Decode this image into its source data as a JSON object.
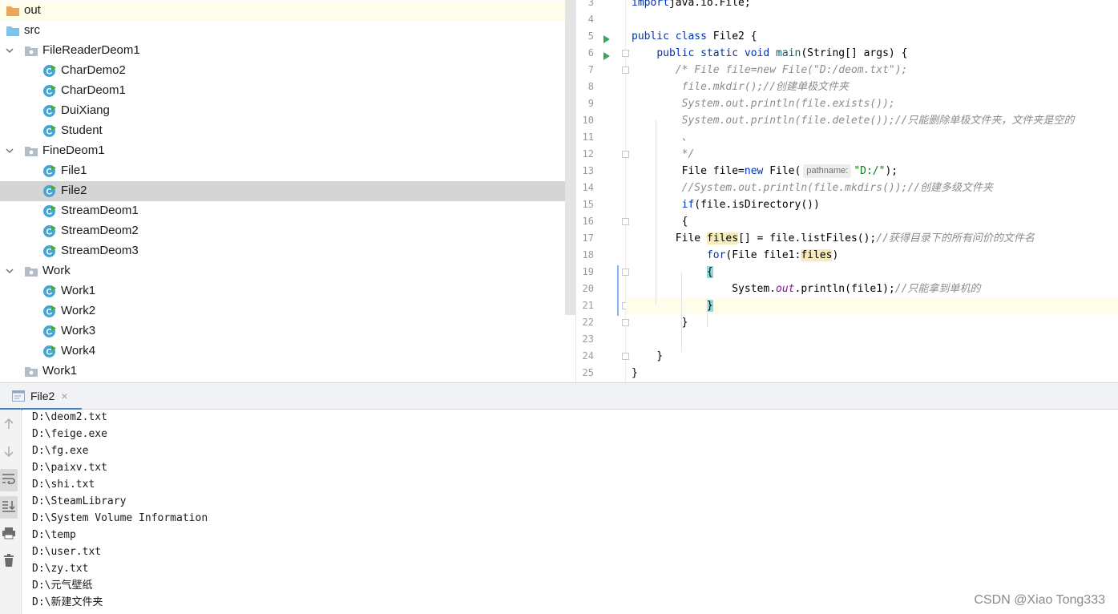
{
  "project_tree": {
    "items": [
      {
        "label": "out",
        "kind": "folder-orange",
        "level": 0,
        "arrow": "none",
        "highlighted": true
      },
      {
        "label": "src",
        "kind": "folder-blue",
        "level": 0,
        "arrow": "none"
      },
      {
        "label": "FileReaderDeom1",
        "kind": "package",
        "level": 0,
        "arrow": "expanded"
      },
      {
        "label": "CharDemo2",
        "kind": "class",
        "level": 1,
        "arrow": "none"
      },
      {
        "label": "CharDeom1",
        "kind": "class",
        "level": 1,
        "arrow": "none"
      },
      {
        "label": "DuiXiang",
        "kind": "class",
        "level": 1,
        "arrow": "none"
      },
      {
        "label": "Student",
        "kind": "class",
        "level": 1,
        "arrow": "none"
      },
      {
        "label": "FineDeom1",
        "kind": "package",
        "level": 0,
        "arrow": "expanded"
      },
      {
        "label": "File1",
        "kind": "class",
        "level": 1,
        "arrow": "none"
      },
      {
        "label": "File2",
        "kind": "class",
        "level": 1,
        "arrow": "none",
        "selected": true
      },
      {
        "label": "StreamDeom1",
        "kind": "class",
        "level": 1,
        "arrow": "none"
      },
      {
        "label": "StreamDeom2",
        "kind": "class",
        "level": 1,
        "arrow": "none"
      },
      {
        "label": "StreamDeom3",
        "kind": "class",
        "level": 1,
        "arrow": "none"
      },
      {
        "label": "Work",
        "kind": "package",
        "level": 0,
        "arrow": "expanded"
      },
      {
        "label": "Work1",
        "kind": "class",
        "level": 1,
        "arrow": "none"
      },
      {
        "label": "Work2",
        "kind": "class",
        "level": 1,
        "arrow": "none"
      },
      {
        "label": "Work3",
        "kind": "class",
        "level": 1,
        "arrow": "none"
      },
      {
        "label": "Work4",
        "kind": "class",
        "level": 1,
        "arrow": "none"
      },
      {
        "label": "Work1",
        "kind": "package",
        "level": 0,
        "arrow": "none"
      }
    ]
  },
  "editor": {
    "lines": [
      {
        "n": "3",
        "tokens": [
          [
            "kw",
            "import"
          ],
          [
            "",
            "java.io.File;"
          ]
        ]
      },
      {
        "n": "4",
        "tokens": []
      },
      {
        "n": "5",
        "run": true,
        "tokens": [
          [
            "kw",
            "public class "
          ],
          [
            "",
            "File2 {"
          ]
        ]
      },
      {
        "n": "6",
        "run": true,
        "fold": true,
        "tokens": [
          [
            "",
            "    "
          ],
          [
            "kw",
            "public static void "
          ],
          [
            "fn",
            "main"
          ],
          [
            "",
            "(String[] args) {"
          ]
        ]
      },
      {
        "n": "7",
        "fold": true,
        "tokens": [
          [
            "",
            "       "
          ],
          [
            "cm",
            "/* File file=new File(\"D:/deom.txt\");"
          ]
        ]
      },
      {
        "n": "8",
        "tokens": [
          [
            "",
            "        "
          ],
          [
            "cm",
            "file.mkdir();//创建单极文件夹"
          ]
        ]
      },
      {
        "n": "9",
        "tokens": [
          [
            "",
            "        "
          ],
          [
            "cm",
            "System.out.println(file.exists());"
          ]
        ]
      },
      {
        "n": "10",
        "tokens": [
          [
            "",
            "        "
          ],
          [
            "cm",
            "System.out.println(file.delete());//只能删除单极文件夹，文件夹是空的"
          ]
        ]
      },
      {
        "n": "11",
        "tokens": [
          [
            "",
            "        "
          ],
          [
            "cm",
            "、"
          ]
        ]
      },
      {
        "n": "12",
        "fold": true,
        "tokens": [
          [
            "",
            "        "
          ],
          [
            "cm",
            "*/"
          ]
        ]
      },
      {
        "n": "13",
        "tokens": [
          [
            "",
            "        File file="
          ],
          [
            "kw",
            "new "
          ],
          [
            "",
            "File("
          ],
          [
            "hint",
            "pathname:"
          ],
          [
            "str",
            "\"D:/\""
          ],
          [
            "",
            ");"
          ]
        ]
      },
      {
        "n": "14",
        "tokens": [
          [
            "",
            "        "
          ],
          [
            "cm",
            "//System.out.println(file.mkdirs());//创建多级文件夹"
          ]
        ]
      },
      {
        "n": "15",
        "tokens": [
          [
            "",
            "        "
          ],
          [
            "kw",
            "if"
          ],
          [
            "",
            "(file.isDirectory())"
          ]
        ]
      },
      {
        "n": "16",
        "fold": true,
        "tokens": [
          [
            "",
            "        {"
          ]
        ]
      },
      {
        "n": "17",
        "tokens": [
          [
            "",
            "       File "
          ],
          [
            "hl",
            "files"
          ],
          [
            "",
            "[] = file.listFiles();"
          ],
          [
            "cm",
            "//获得目录下的所有问价的文件名"
          ]
        ]
      },
      {
        "n": "18",
        "tokens": [
          [
            "",
            "            "
          ],
          [
            "kw",
            "for"
          ],
          [
            "",
            "(File file1:"
          ],
          [
            "hl",
            "files"
          ],
          [
            "",
            ")"
          ]
        ]
      },
      {
        "n": "19",
        "fold": true,
        "tokens": [
          [
            "",
            "            "
          ],
          [
            "brace",
            "{"
          ]
        ]
      },
      {
        "n": "20",
        "tokens": [
          [
            "",
            "                System."
          ],
          [
            "fld",
            "out"
          ],
          [
            "",
            ".println(file1);"
          ],
          [
            "cm",
            "//只能拿到单机的"
          ]
        ]
      },
      {
        "n": "21",
        "fold": true,
        "current": true,
        "tokens": [
          [
            "",
            "            "
          ],
          [
            "brace",
            "}"
          ]
        ]
      },
      {
        "n": "22",
        "fold": true,
        "tokens": [
          [
            "",
            "        }"
          ]
        ]
      },
      {
        "n": "23",
        "tokens": []
      },
      {
        "n": "24",
        "fold": true,
        "tokens": [
          [
            "",
            "    }"
          ]
        ]
      },
      {
        "n": "25",
        "tokens": [
          [
            "",
            "}"
          ]
        ]
      }
    ]
  },
  "run_panel": {
    "tab_label": "File2",
    "tab_close": "×",
    "output": [
      "D:\\deom2.txt",
      "D:\\feige.exe",
      "D:\\fg.exe",
      "D:\\paixv.txt",
      "D:\\shi.txt",
      "D:\\SteamLibrary",
      "D:\\System Volume Information",
      "D:\\temp",
      "D:\\user.txt",
      "D:\\zy.txt",
      "D:\\元气壁纸",
      "D:\\新建文件夹"
    ],
    "toolbar": [
      {
        "name": "up-arrow-icon",
        "on": false
      },
      {
        "name": "down-arrow-icon",
        "on": false
      },
      {
        "name": "soft-wrap-icon",
        "on": true
      },
      {
        "name": "scroll-to-end-icon",
        "on": true
      },
      {
        "name": "print-icon",
        "on": false
      },
      {
        "name": "trash-icon",
        "on": false
      }
    ]
  },
  "watermark": "CSDN @Xiao Tong333",
  "colors": {
    "keyword": "#0033b3",
    "comment": "#8c8c8c",
    "string": "#067d17",
    "selection": "#d5d5d5",
    "caret_row": "#fdfdea",
    "tab_underline": "#4083c9"
  }
}
